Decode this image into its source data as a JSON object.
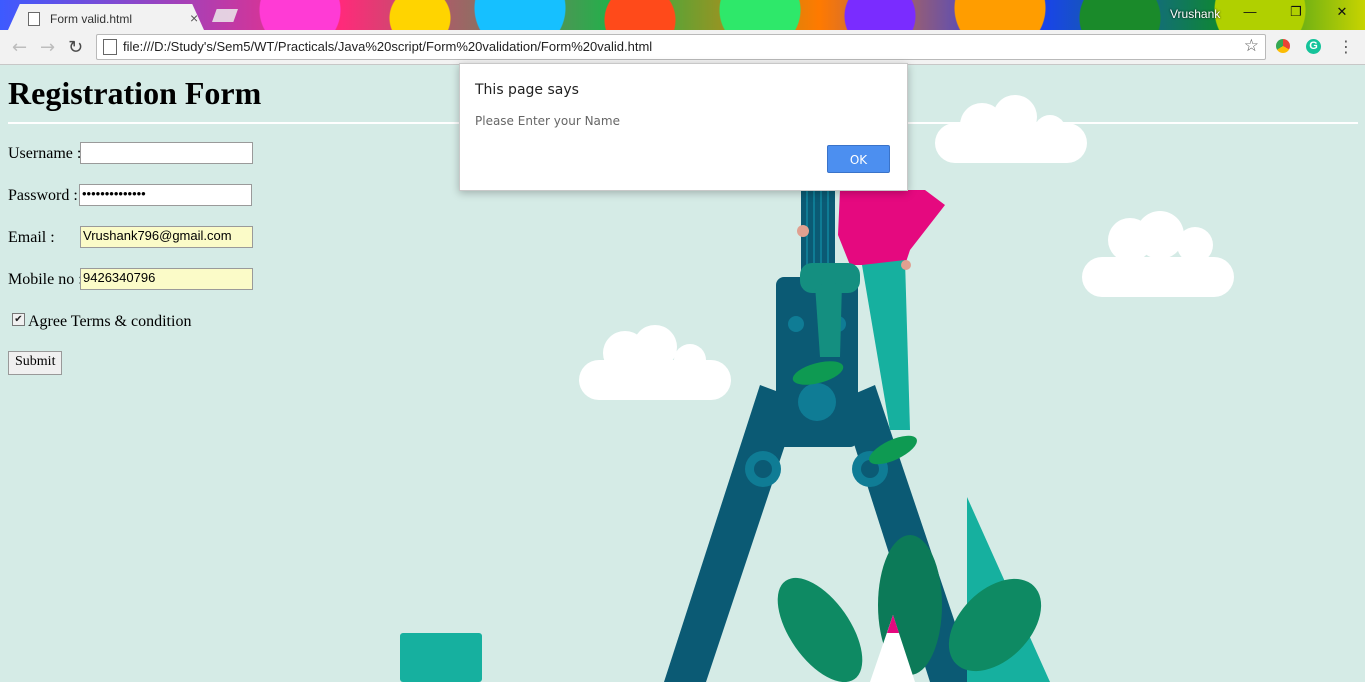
{
  "browser": {
    "tab_title": "Form valid.html",
    "close_glyph": "×",
    "user_name": "Vrushank",
    "window_controls": [
      "—",
      "❐",
      "✕"
    ],
    "url": "file:///D:/Study's/Sem5/WT/Practicals/Java%20script/Form%20validation/Form%20valid.html",
    "icons": {
      "back": "←",
      "forward": "→",
      "reload": "↻",
      "bookmark": "☆",
      "menu": "⋮",
      "extension_letter": "G"
    }
  },
  "form": {
    "title": "Registration Form",
    "username_label": "Username :",
    "username_value": "",
    "password_label": "Password :",
    "password_value": "••••••••••••••",
    "email_label": "Email :",
    "email_value": "Vrushank796@gmail.com",
    "mobile_label": "Mobile no :",
    "mobile_value": "9426340796",
    "terms_label": "Agree Terms & condition",
    "terms_checked": true,
    "check_glyph": "✔",
    "submit_label": "Submit"
  },
  "dialog": {
    "title": "This page says",
    "message": "Please Enter your Name",
    "ok_label": "OK"
  },
  "colors": {
    "page_bg": "#d5ebe6",
    "dialog_button": "#4c8ff0",
    "autofill_bg": "#fbfbc8"
  }
}
